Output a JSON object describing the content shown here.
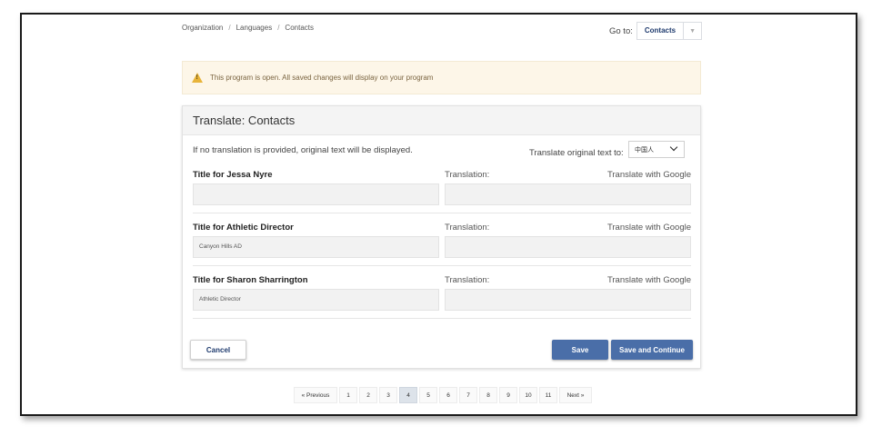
{
  "breadcrumb": [
    "Organization",
    "Languages",
    "Contacts"
  ],
  "goto": {
    "label": "Go to:",
    "value": "Contacts"
  },
  "alert": {
    "text": "This program is open. All saved changes will display on your program"
  },
  "card": {
    "title": "Translate: Contacts",
    "intro": "If no translation is provided, original text will be displayed.",
    "translate_label": "Translate original text to:",
    "language": "中国人"
  },
  "rows": [
    {
      "title": "Title for Jessa Nyre",
      "translation_label": "Translation:",
      "google": "Translate with Google",
      "original": "",
      "translation": ""
    },
    {
      "title": "Title for Athletic Director",
      "translation_label": "Translation:",
      "google": "Translate with Google",
      "original": "Canyon Hills AD",
      "translation": ""
    },
    {
      "title": "Title for Sharon Sharrington",
      "translation_label": "Translation:",
      "google": "Translate with Google",
      "original": "Athletic Director",
      "translation": ""
    }
  ],
  "buttons": {
    "cancel": "Cancel",
    "save": "Save",
    "save_continue": "Save and Continue"
  },
  "pagination": {
    "prev": "« Previous",
    "pages": [
      "1",
      "2",
      "3",
      "4",
      "5",
      "6",
      "7",
      "8",
      "9",
      "10",
      "11"
    ],
    "current": "4",
    "next": "Next »"
  }
}
